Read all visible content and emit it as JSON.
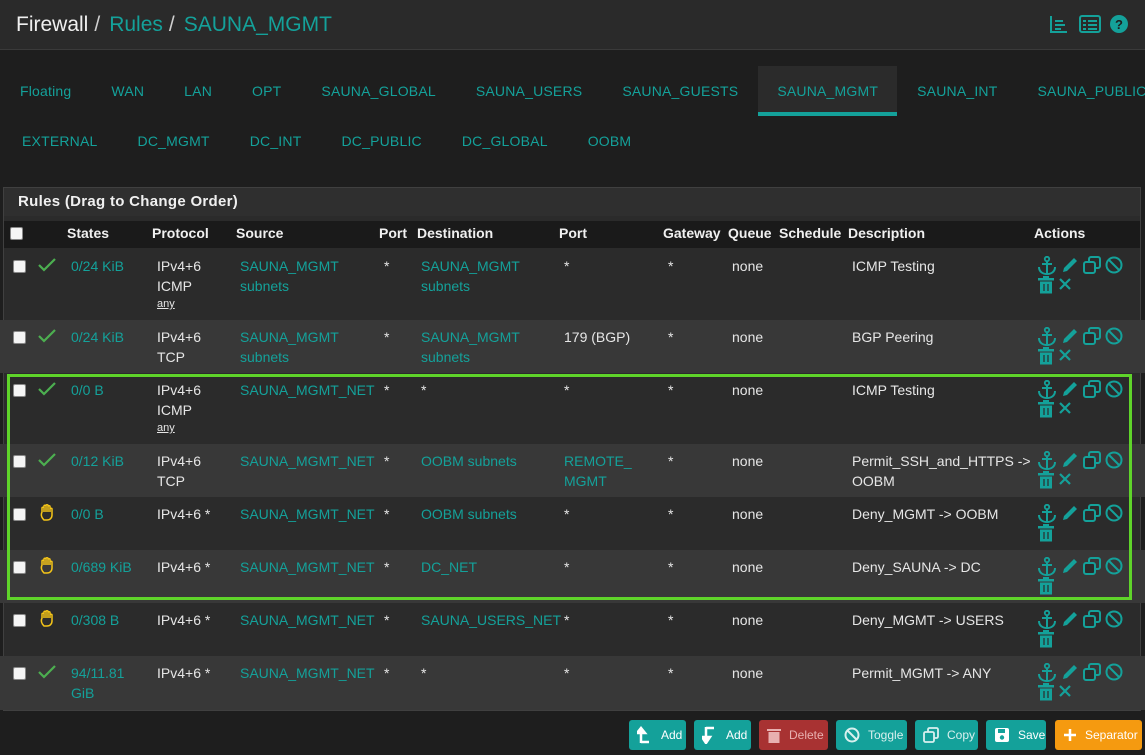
{
  "breadcrumb": {
    "item1": "Firewall",
    "item2": "Rules",
    "item3": "SAUNA_MGMT"
  },
  "tabs_row1": [
    "Floating",
    "WAN",
    "LAN",
    "OPT",
    "SAUNA_GLOBAL",
    "SAUNA_USERS",
    "SAUNA_GUESTS",
    "SAUNA_MGMT",
    "SAUNA_INT",
    "SAUNA_PUBLIC"
  ],
  "tabs_row2": [
    "EXTERNAL",
    "DC_MGMT",
    "DC_INT",
    "DC_PUBLIC",
    "DC_GLOBAL",
    "OOBM"
  ],
  "active_tab": "SAUNA_MGMT",
  "panel_title": "Rules (Drag to Change Order)",
  "columns": {
    "states": "States",
    "protocol": "Protocol",
    "source": "Source",
    "port": "Port",
    "destination": "Destination",
    "dport": "Port",
    "gateway": "Gateway",
    "queue": "Queue",
    "schedule": "Schedule",
    "description": "Description",
    "actions": "Actions"
  },
  "rules": [
    {
      "status": "pass",
      "states": "0/24 KiB",
      "proto1": "IPv4+6",
      "proto2": "ICMP",
      "proto3": "any",
      "source1": "SAUNA_MGMT",
      "source2": "subnets",
      "sport": "*",
      "dest1": "SAUNA_MGMT",
      "dest2": "subnets",
      "dport1": "*",
      "dport2": "",
      "gateway": "*",
      "queue": "none",
      "desc1": "ICMP Testing",
      "desc2": ""
    },
    {
      "status": "pass",
      "states": "0/24 KiB",
      "proto1": "IPv4+6",
      "proto2": "TCP",
      "proto3": "",
      "source1": "SAUNA_MGMT",
      "source2": "subnets",
      "sport": "*",
      "dest1": "SAUNA_MGMT",
      "dest2": "subnets",
      "dport1": "179 (BGP)",
      "dport2": "",
      "gateway": "*",
      "queue": "none",
      "desc1": "BGP Peering",
      "desc2": ""
    },
    {
      "status": "pass",
      "states": "0/0 B",
      "proto1": "IPv4+6",
      "proto2": "ICMP",
      "proto3": "any",
      "source1": "SAUNA_MGMT_NET",
      "source2": "",
      "sport": "*",
      "dest1": "*",
      "dest2": "",
      "dport1": "*",
      "dport2": "",
      "gateway": "*",
      "queue": "none",
      "desc1": "ICMP Testing",
      "desc2": ""
    },
    {
      "status": "pass",
      "states": "0/12 KiB",
      "proto1": "IPv4+6",
      "proto2": "TCP",
      "proto3": "",
      "source1": "SAUNA_MGMT_NET",
      "source2": "",
      "sport": "*",
      "dest1": "OOBM subnets",
      "dest2": "",
      "dport1": "REMOTE_",
      "dport2": "MGMT",
      "gateway": "*",
      "queue": "none",
      "desc1": "Permit_SSH_and_HTTPS ->",
      "desc2": "OOBM"
    },
    {
      "status": "block",
      "states": "0/0 B",
      "proto1": "IPv4+6 *",
      "proto2": "",
      "proto3": "",
      "source1": "SAUNA_MGMT_NET",
      "source2": "",
      "sport": "*",
      "dest1": "OOBM subnets",
      "dest2": "",
      "dport1": "*",
      "dport2": "",
      "gateway": "*",
      "queue": "none",
      "desc1": "Deny_MGMT -> OOBM",
      "desc2": ""
    },
    {
      "status": "block",
      "states": "0/689 KiB",
      "proto1": "IPv4+6 *",
      "proto2": "",
      "proto3": "",
      "source1": "SAUNA_MGMT_NET",
      "source2": "",
      "sport": "*",
      "dest1": "DC_NET",
      "dest2": "",
      "dport1": "*",
      "dport2": "",
      "gateway": "*",
      "queue": "none",
      "desc1": "Deny_SAUNA -> DC",
      "desc2": ""
    },
    {
      "status": "block",
      "states": "0/308 B",
      "proto1": "IPv4+6 *",
      "proto2": "",
      "proto3": "",
      "source1": "SAUNA_MGMT_NET",
      "source2": "",
      "sport": "*",
      "dest1": "SAUNA_USERS_NET",
      "dest2": "",
      "dport1": "*",
      "dport2": "",
      "gateway": "*",
      "queue": "none",
      "desc1": "Deny_MGMT -> USERS",
      "desc2": ""
    },
    {
      "status": "pass",
      "states": "94/11.81",
      "states2": "GiB",
      "proto1": "IPv4+6 *",
      "proto2": "",
      "proto3": "",
      "source1": "SAUNA_MGMT_NET",
      "source2": "",
      "sport": "*",
      "dest1": "*",
      "dest2": "",
      "dport1": "*",
      "dport2": "",
      "gateway": "*",
      "queue": "none",
      "desc1": "Permit_MGMT -> ANY",
      "desc2": ""
    }
  ],
  "buttons": {
    "add_top": "Add",
    "add_bottom": "Add",
    "delete": "Delete",
    "toggle": "Toggle",
    "copy": "Copy",
    "save": "Save",
    "separator": "Separator"
  },
  "colors": {
    "accent": "#14a19a",
    "pass": "#4caf50",
    "block": "#f5c518",
    "highlight": "#5fd42a",
    "delete": "#b03030",
    "separator": "#f59a10"
  }
}
